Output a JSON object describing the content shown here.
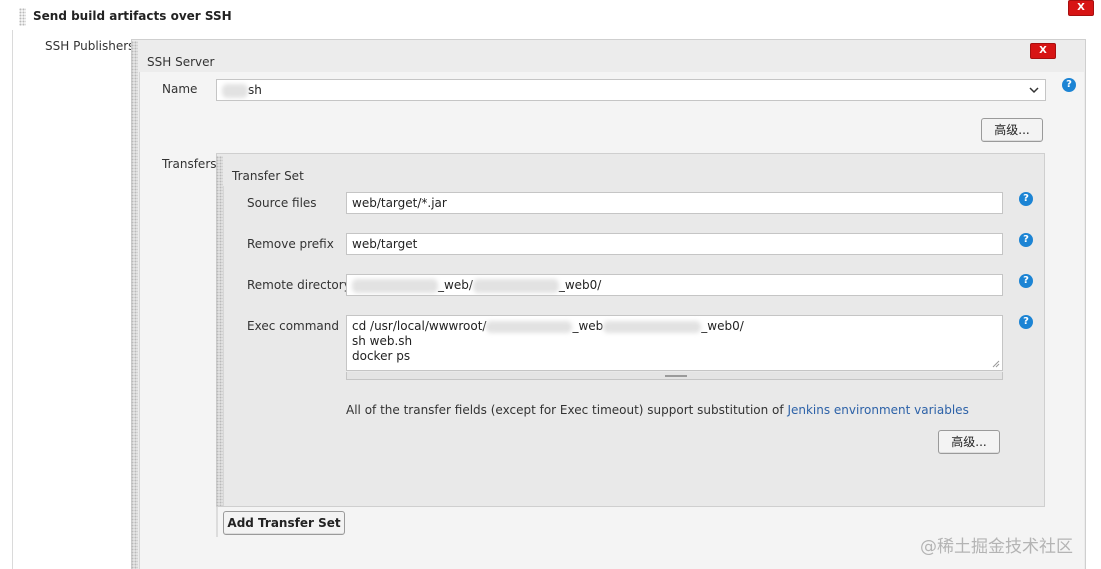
{
  "section": {
    "title": "Send build artifacts over SSH",
    "delete_label": "X"
  },
  "ssh_publishers": {
    "label": "SSH Publishers",
    "server": {
      "title": "SSH Server",
      "delete_label": "X",
      "name_label": "Name",
      "name_value_suffix": "sh",
      "advanced_label": "高级...",
      "help": "?"
    }
  },
  "transfers": {
    "label": "Transfers",
    "set_title": "Transfer Set",
    "source_files": {
      "label": "Source files",
      "value": "web/target/*.jar"
    },
    "remove_prefix": {
      "label": "Remove prefix",
      "value": "web/target"
    },
    "remote_directory": {
      "label": "Remote directory",
      "seg1": "_web/",
      "seg2": "_web0/"
    },
    "exec_command": {
      "label": "Exec command",
      "line1_prefix": "cd /usr/local/wwwroot/",
      "line1_mid": "_web",
      "line1_end": "_web0/",
      "line2": "sh web.sh",
      "line3": "docker ps"
    },
    "note_text": "All of the transfer fields (except for Exec timeout) support substitution of ",
    "note_link": "Jenkins environment variables",
    "advanced_label": "高级...",
    "add_button": "Add Transfer Set"
  },
  "watermark": "@稀土掘金技术社区",
  "colors": {
    "link": "#2d62a8",
    "delete": "#d71414",
    "help": "#1c84d4",
    "panel": "#ececec",
    "panel_inner": "#e9e9e9"
  }
}
